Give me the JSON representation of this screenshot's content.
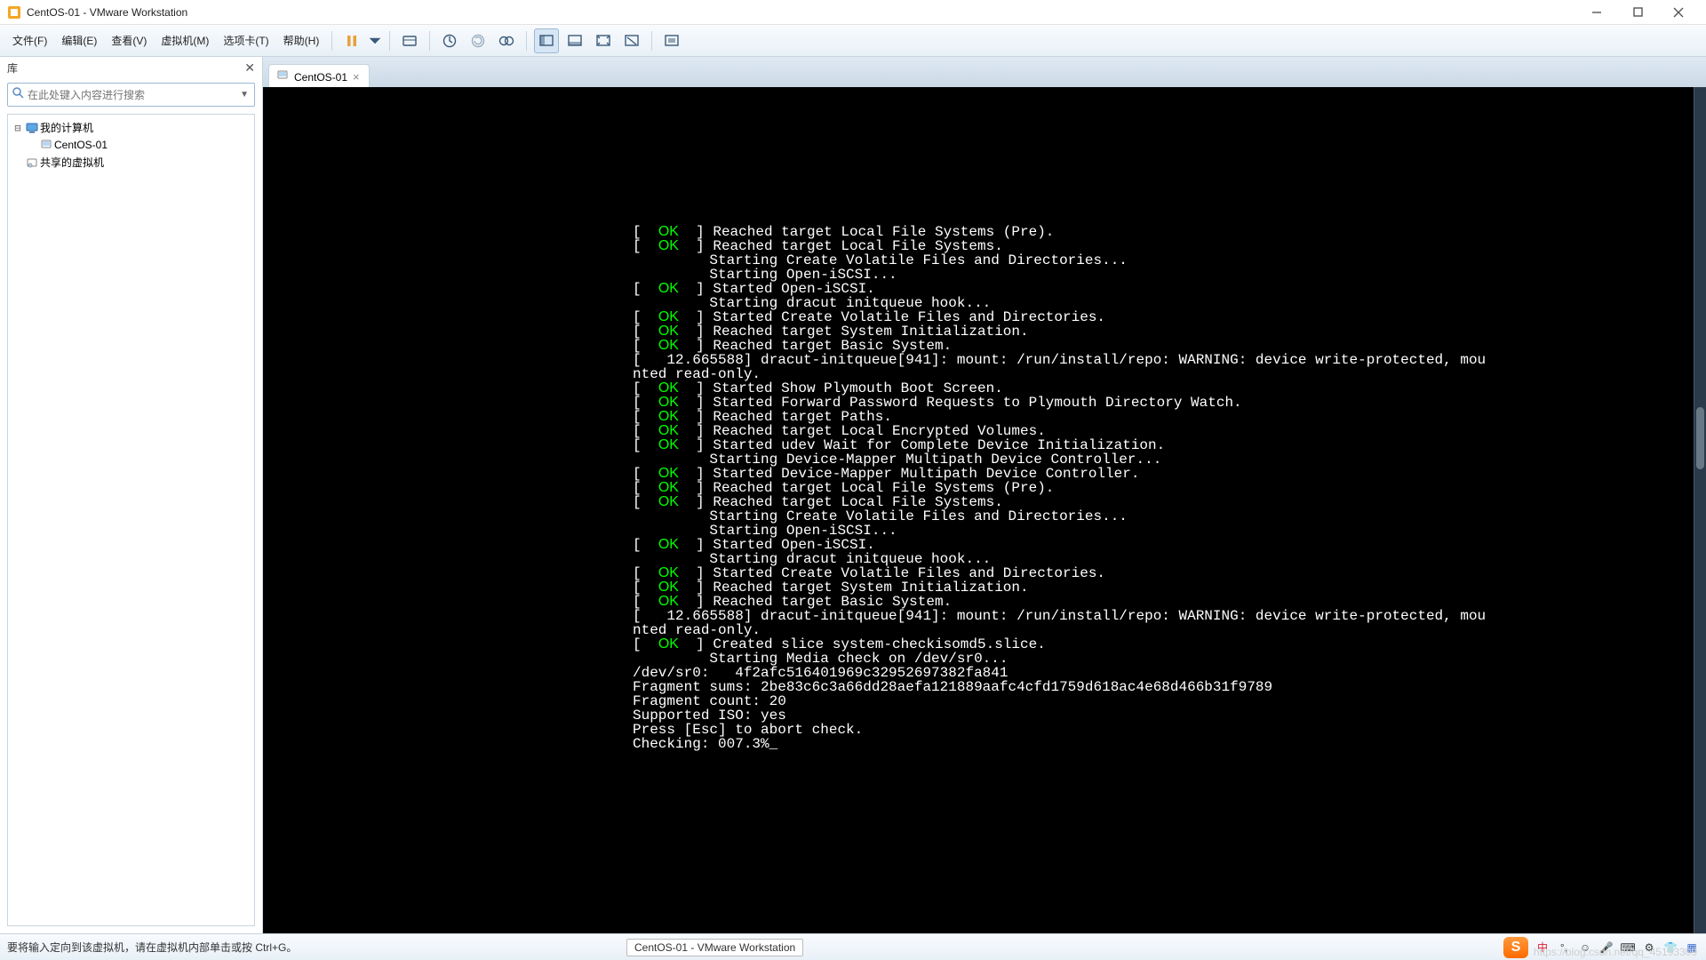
{
  "window": {
    "title": "CentOS-01 - VMware Workstation"
  },
  "menus": {
    "file": "文件(F)",
    "edit": "编辑(E)",
    "view": "查看(V)",
    "vm": "虚拟机(M)",
    "tabs": "选项卡(T)",
    "help": "帮助(H)"
  },
  "sidebar": {
    "header": "库",
    "search_placeholder": "在此处键入内容进行搜索",
    "nodes": {
      "my_computer": "我的计算机",
      "centos": "CentOS-01",
      "shared": "共享的虚拟机"
    }
  },
  "tab": {
    "label": "CentOS-01"
  },
  "console_lines": [
    {
      "s": "OK",
      "t": "Reached target Local File Systems (Pre)."
    },
    {
      "s": "OK",
      "t": "Reached target Local File Systems."
    },
    {
      "s": "",
      "t": "Starting Create Volatile Files and Directories..."
    },
    {
      "s": "",
      "t": "Starting Open-iSCSI..."
    },
    {
      "s": "OK",
      "t": "Started Open-iSCSI."
    },
    {
      "s": "",
      "t": "Starting dracut initqueue hook..."
    },
    {
      "s": "OK",
      "t": "Started Create Volatile Files and Directories."
    },
    {
      "s": "OK",
      "t": "Reached target System Initialization."
    },
    {
      "s": "OK",
      "t": "Reached target Basic System."
    },
    {
      "s": "WRAP",
      "t": "[   12.665588] dracut-initqueue[941]: mount: /run/install/repo: WARNING: device write-protected, mou"
    },
    {
      "s": "WRAP2",
      "t": "nted read-only."
    },
    {
      "s": "OK",
      "t": "Started Show Plymouth Boot Screen."
    },
    {
      "s": "OK",
      "t": "Started Forward Password Requests to Plymouth Directory Watch."
    },
    {
      "s": "OK",
      "t": "Reached target Paths."
    },
    {
      "s": "OK",
      "t": "Reached target Local Encrypted Volumes."
    },
    {
      "s": "OK",
      "t": "Started udev Wait for Complete Device Initialization."
    },
    {
      "s": "",
      "t": "Starting Device-Mapper Multipath Device Controller..."
    },
    {
      "s": "OK",
      "t": "Started Device-Mapper Multipath Device Controller."
    },
    {
      "s": "OK",
      "t": "Reached target Local File Systems (Pre)."
    },
    {
      "s": "OK",
      "t": "Reached target Local File Systems."
    },
    {
      "s": "",
      "t": "Starting Create Volatile Files and Directories..."
    },
    {
      "s": "",
      "t": "Starting Open-iSCSI..."
    },
    {
      "s": "OK",
      "t": "Started Open-iSCSI."
    },
    {
      "s": "",
      "t": "Starting dracut initqueue hook..."
    },
    {
      "s": "OK",
      "t": "Started Create Volatile Files and Directories."
    },
    {
      "s": "OK",
      "t": "Reached target System Initialization."
    },
    {
      "s": "OK",
      "t": "Reached target Basic System."
    },
    {
      "s": "WRAP",
      "t": "[   12.665588] dracut-initqueue[941]: mount: /run/install/repo: WARNING: device write-protected, mou"
    },
    {
      "s": "WRAP2",
      "t": "nted read-only."
    },
    {
      "s": "OK",
      "t": "Created slice system-checkisomd5.slice."
    },
    {
      "s": "",
      "t": "Starting Media check on /dev/sr0..."
    },
    {
      "s": "RAW",
      "t": "/dev/sr0:   4f2afc516401969c32952697382fa841"
    },
    {
      "s": "RAW",
      "t": "Fragment sums: 2be83c6c3a66dd28aefa121889aafc4cfd1759d618ac4e68d466b31f9789"
    },
    {
      "s": "RAW",
      "t": "Fragment count: 20"
    },
    {
      "s": "RAW",
      "t": "Supported ISO: yes"
    },
    {
      "s": "RAW",
      "t": "Press [Esc] to abort check."
    },
    {
      "s": "RAW",
      "t": "Checking: 007.3%_"
    }
  ],
  "status": {
    "msg": "要将输入定向到该虚拟机，请在虚拟机内部单击或按 Ctrl+G。",
    "pill": "CentOS-01 - VMware Workstation",
    "ime": "S",
    "ime_lang": "中"
  },
  "watermark": "https://blog.csdn.net/qq_45193309"
}
